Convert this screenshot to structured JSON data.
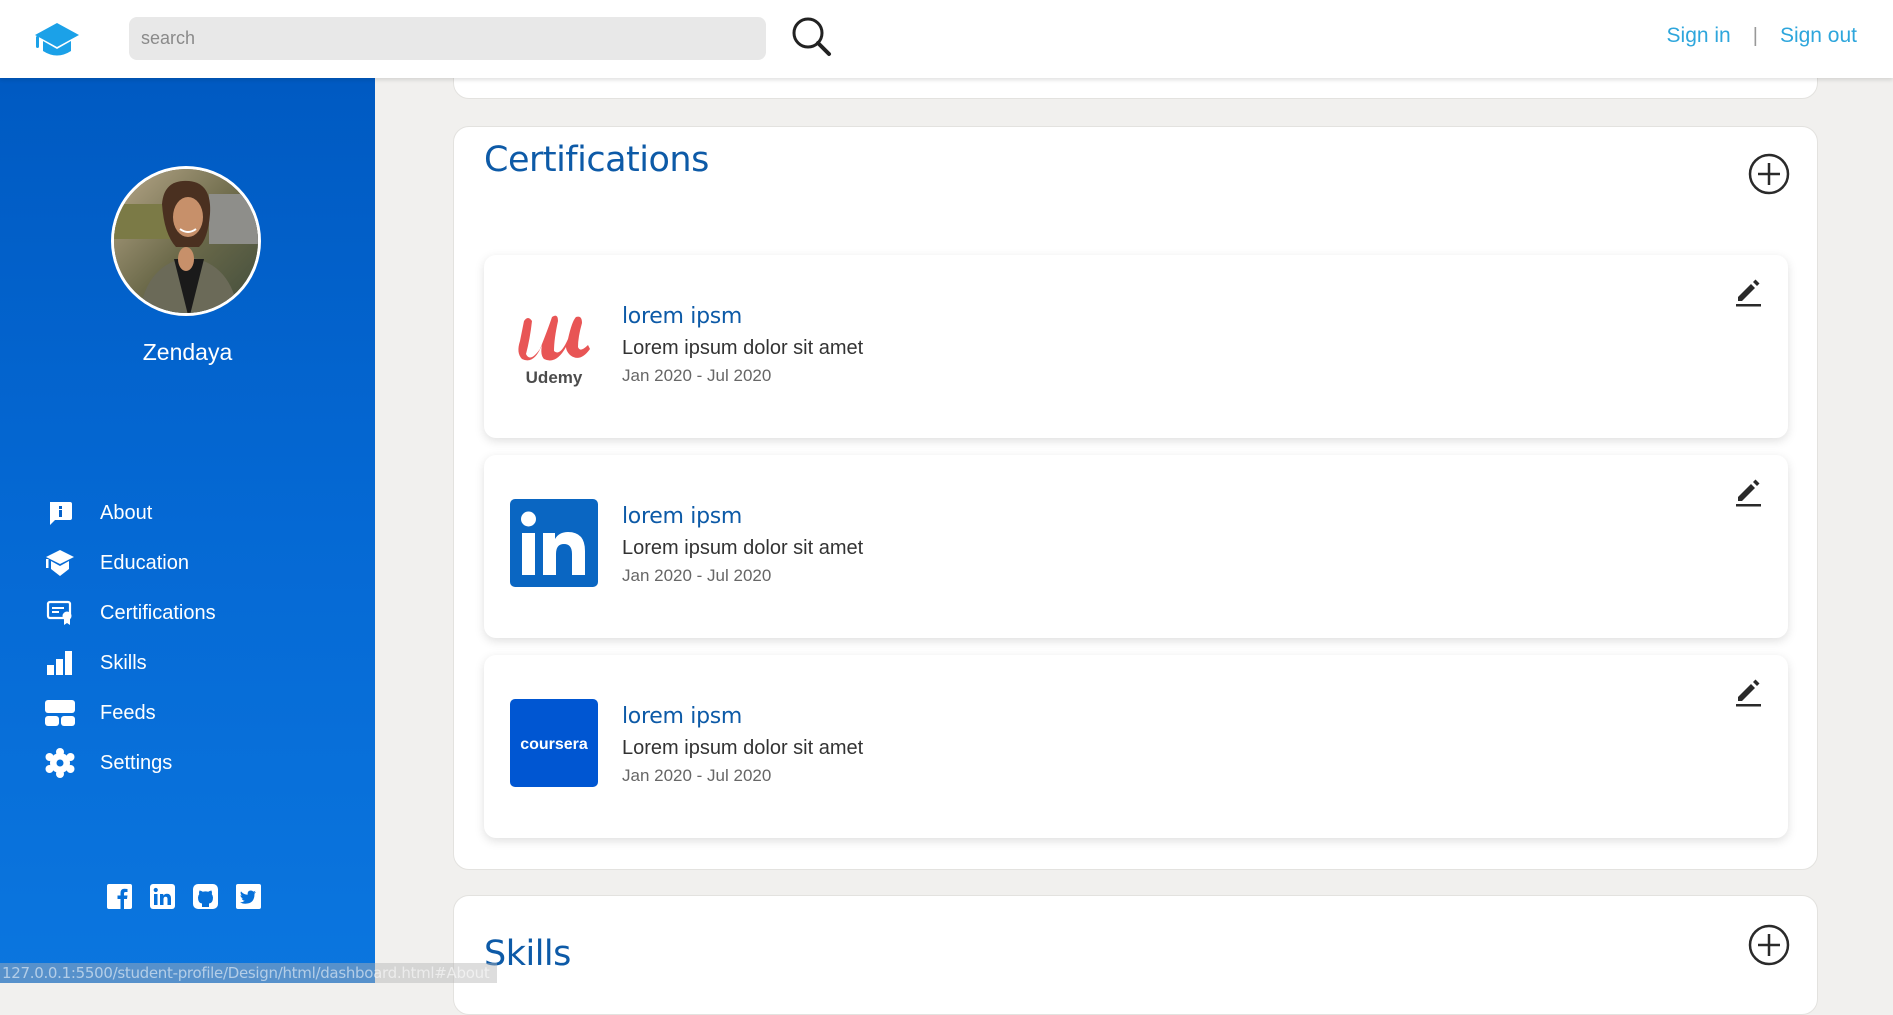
{
  "header": {
    "logo_icon": "graduation-cap-icon",
    "search_placeholder": "search",
    "search_value": "",
    "search_icon": "magnifier-icon",
    "sign_in": "Sign in",
    "separator": "|",
    "sign_out": "Sign out"
  },
  "sidebar": {
    "profile_name": "Zendaya",
    "avatar_alt": "profile photo",
    "nav": [
      {
        "label": "About",
        "icon": "info-bubble-icon"
      },
      {
        "label": "Education",
        "icon": "graduation-cap-icon"
      },
      {
        "label": "Certifications",
        "icon": "certificate-icon"
      },
      {
        "label": "Skills",
        "icon": "bar-chart-icon"
      },
      {
        "label": "Feeds",
        "icon": "feeds-layout-icon"
      },
      {
        "label": "Settings",
        "icon": "gear-icon"
      }
    ],
    "socials": [
      {
        "name": "facebook",
        "icon": "facebook-icon"
      },
      {
        "name": "linkedin",
        "icon": "linkedin-icon"
      },
      {
        "name": "github",
        "icon": "github-icon"
      },
      {
        "name": "twitter",
        "icon": "twitter-icon"
      }
    ]
  },
  "main": {
    "certifications": {
      "title": "Certifications",
      "add_icon": "plus-circle-icon",
      "items": [
        {
          "provider": "Udemy",
          "logo_text": "Udemy",
          "title": "lorem ipsm",
          "description": "Lorem ipsum dolor sit amet",
          "date": "Jan 2020 - Jul 2020",
          "edit_icon": "pencil-icon"
        },
        {
          "provider": "LinkedIn",
          "logo_text": "in",
          "title": "lorem ipsm",
          "description": "Lorem ipsum dolor sit amet",
          "date": "Jan 2020 - Jul 2020",
          "edit_icon": "pencil-icon"
        },
        {
          "provider": "Coursera",
          "logo_text": "coursera",
          "title": "lorem ipsm",
          "description": "Lorem ipsum dolor sit amet",
          "date": "Jan 2020 - Jul 2020",
          "edit_icon": "pencil-icon"
        }
      ]
    },
    "skills": {
      "title": "Skills",
      "add_icon": "plus-circle-icon"
    }
  },
  "status_bar": {
    "url": "127.0.0.1:5500/student-profile/Design/html/dashboard.html#About"
  },
  "colors": {
    "sidebar_top": "#005ac2",
    "sidebar_bottom": "#0b76df",
    "heading": "#0d5aa7",
    "link": "#2ea6dc",
    "udemy": "#ea5252",
    "linkedin": "#0a66c2",
    "coursera": "#0056d2"
  }
}
